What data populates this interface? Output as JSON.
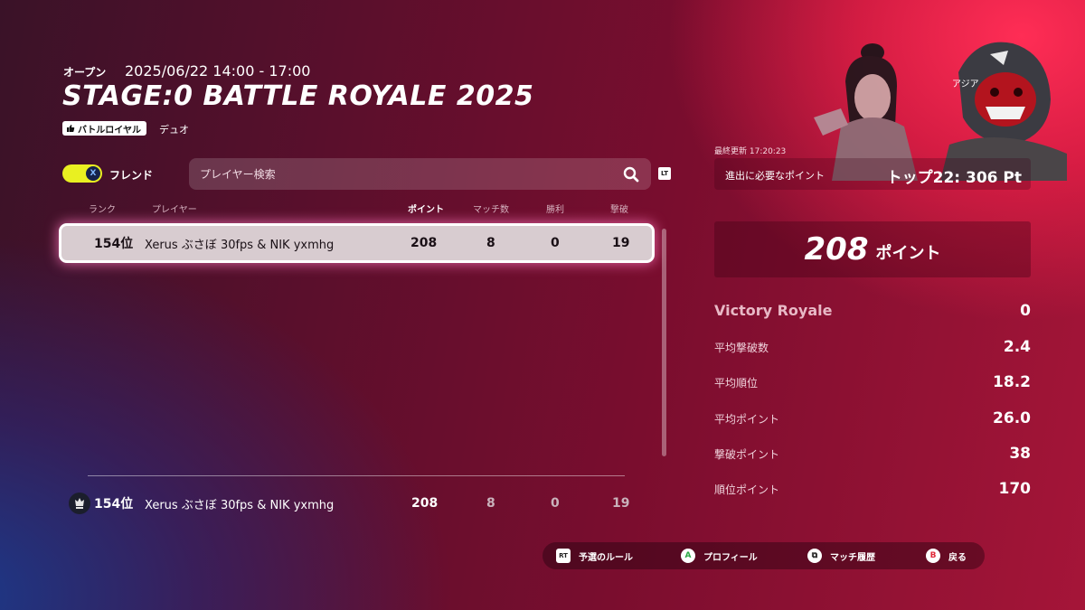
{
  "event": {
    "status": "オープン",
    "time": "2025/06/22 14:00 - 17:00",
    "title": "STAGE:0 BATTLE ROYALE 2025",
    "mode_badge": "バトルロイヤル",
    "mode_type": "デュオ"
  },
  "toggle": {
    "key": "X",
    "label": "フレンド",
    "on": true
  },
  "search": {
    "placeholder": "プレイヤー検索",
    "shortcut": "LT"
  },
  "table": {
    "headers": {
      "rank": "ランク",
      "player": "プレイヤー",
      "points": "ポイント",
      "matches": "マッチ数",
      "wins": "勝利",
      "elims": "撃破"
    },
    "rows": [
      {
        "rank": "154位",
        "player": "Xerus ぶさぼ 30fps & NIK yxmhg",
        "points": "208",
        "matches": "8",
        "wins": "0",
        "elims": "19"
      }
    ]
  },
  "my_row": {
    "rank": "154位",
    "player": "Xerus ぶさぼ 30fps & NIK yxmhg",
    "points": "208",
    "matches": "8",
    "wins": "0",
    "elims": "19"
  },
  "sidebar": {
    "region": "アジア",
    "updated": "最終更新 17:20:23",
    "advance_label": "進出に必要なポイント",
    "advance_value": "トップ22: 306 Pt",
    "total_points": "208",
    "points_unit": "ポイント",
    "stats": [
      {
        "label": "Victory Royale",
        "value": "0"
      },
      {
        "label": "平均撃破数",
        "value": "2.4"
      },
      {
        "label": "平均順位",
        "value": "18.2"
      },
      {
        "label": "平均ポイント",
        "value": "26.0"
      },
      {
        "label": "撃破ポイント",
        "value": "38"
      },
      {
        "label": "順位ポイント",
        "value": "170"
      }
    ]
  },
  "footer": {
    "rules": {
      "key": "RT",
      "label": "予選のルール"
    },
    "profile": {
      "key": "A",
      "label": "プロフィール"
    },
    "history": {
      "key": "⧉",
      "label": "マッチ履歴"
    },
    "back": {
      "key": "B",
      "label": "戻る"
    }
  },
  "colors": {
    "toggle": "#e9f021",
    "accent": "#ff2d55",
    "highlight_glow": "#ff78be"
  }
}
